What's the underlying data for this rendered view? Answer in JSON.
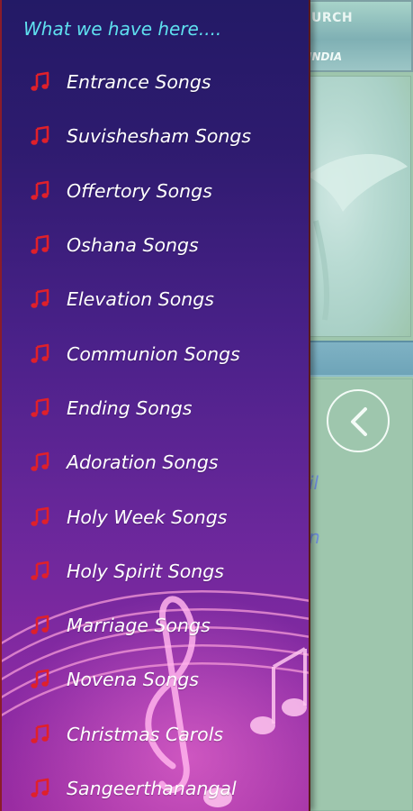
{
  "background": {
    "banner_title": "URCH",
    "banner_subtitle": "INDIA",
    "partial_text_1": "il",
    "partial_text_2": "n",
    "back_icon": "chevron-left-icon"
  },
  "drawer": {
    "title": "What we have here....",
    "item_icon": "music-note-icon",
    "icon_color": "#e0202a",
    "items": [
      {
        "label": "Entrance Songs"
      },
      {
        "label": "Suvishesham Songs"
      },
      {
        "label": "Offertory Songs"
      },
      {
        "label": "Oshana Songs"
      },
      {
        "label": "Elevation Songs"
      },
      {
        "label": "Communion Songs"
      },
      {
        "label": "Ending Songs"
      },
      {
        "label": "Adoration Songs"
      },
      {
        "label": "Holy Week Songs"
      },
      {
        "label": "Holy Spirit Songs"
      },
      {
        "label": "Marriage Songs"
      },
      {
        "label": "Novena Songs"
      },
      {
        "label": "Christmas Carols"
      },
      {
        "label": "Sangeerthanangal"
      }
    ]
  }
}
